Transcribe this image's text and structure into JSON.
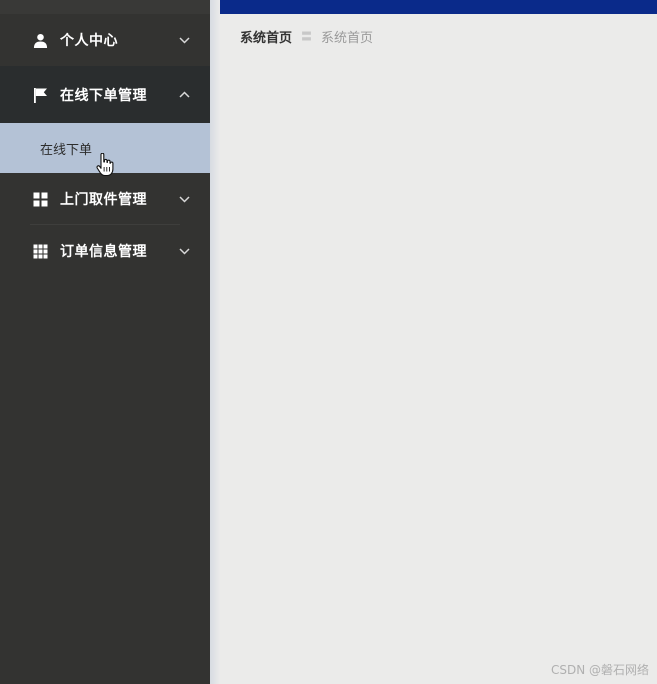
{
  "sidebar": {
    "items": [
      {
        "label": "个人中心",
        "icon": "user-icon",
        "expanded": false
      },
      {
        "label": "在线下单管理",
        "icon": "flag-icon",
        "expanded": true,
        "children": [
          {
            "label": "在线下单"
          }
        ]
      },
      {
        "label": "上门取件管理",
        "icon": "grid-4-icon",
        "expanded": false
      },
      {
        "label": "订单信息管理",
        "icon": "grid-9-icon",
        "expanded": false
      }
    ]
  },
  "breadcrumb": {
    "home": "系统首页",
    "separator": "〓",
    "current": "系统首页"
  },
  "watermark": "CSDN @磐石网络",
  "colors": {
    "sidebar_bg": "#333331",
    "submenu_active_bg": "#b4c2d6",
    "topbar": "#0a2a8a",
    "main_bg": "#ebebea"
  }
}
